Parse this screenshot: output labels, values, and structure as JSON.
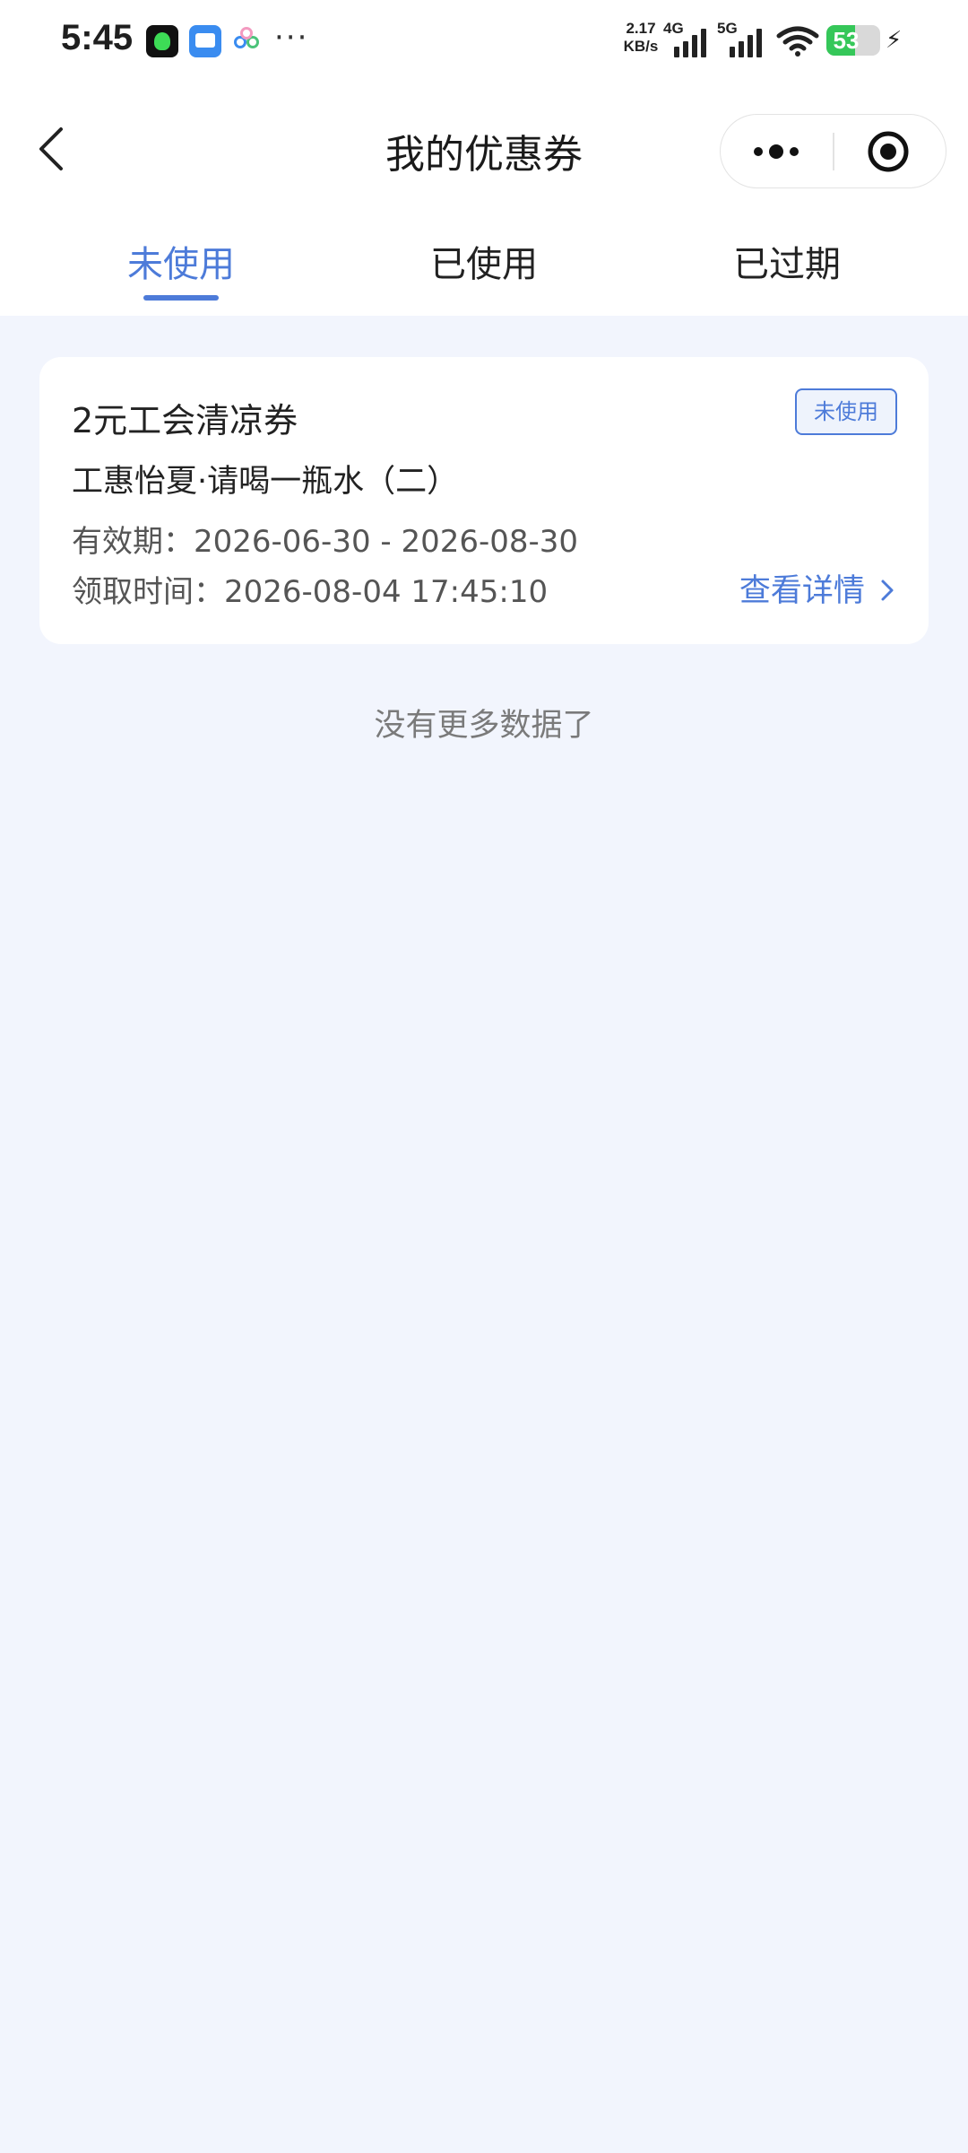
{
  "status_bar": {
    "time": "5:45",
    "more": "···",
    "net_speed_value": "2.17",
    "net_speed_unit": "KB/s",
    "gen1": "4G",
    "gen2": "5G",
    "battery_level": "53",
    "battery_fraction": 0.53,
    "icons": [
      "app-icon-green",
      "app-icon-blue",
      "app-icon-rings",
      "wifi-icon",
      "signal-icon",
      "battery-icon",
      "charging-icon"
    ]
  },
  "nav": {
    "title": "我的优惠券"
  },
  "tabs": [
    {
      "label": "未使用",
      "active": true
    },
    {
      "label": "已使用",
      "active": false
    },
    {
      "label": "已过期",
      "active": false
    }
  ],
  "coupons": [
    {
      "name": "2元工会清凉券",
      "badge": "未使用",
      "description": "工惠怡夏·请喝一瓶水（二）",
      "validity": "有效期：2026-06-30 - 2026-08-30",
      "received": "领取时间：2026-08-04 17:45:10",
      "detail_link": "查看详情"
    }
  ],
  "footer": {
    "no_more": "没有更多数据了"
  },
  "colors": {
    "accent": "#4d7bd9",
    "page_bg": "#f2f5fd",
    "battery_green": "#35c759"
  }
}
